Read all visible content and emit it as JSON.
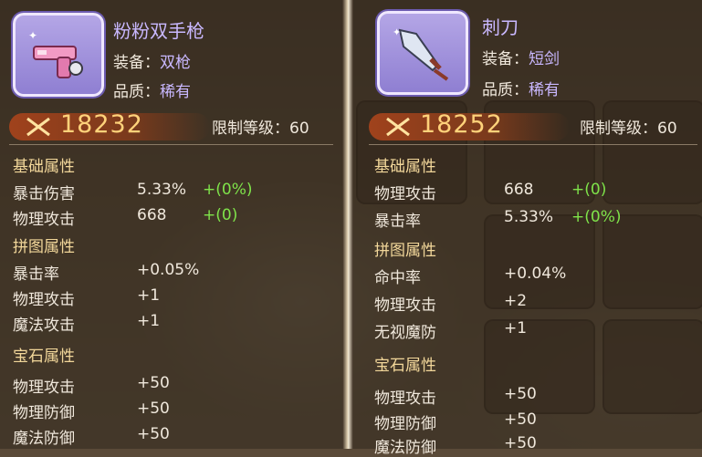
{
  "left": {
    "item_name": "粉粉双手枪",
    "equip_label": "装备：",
    "equip_value": "双枪",
    "quality_label": "品质：",
    "quality_value": "稀有",
    "power": "18232",
    "level_limit_label": "限制等级：",
    "level_limit_value": "60",
    "base_title": "基础属性",
    "base": [
      {
        "k": "暴击伤害",
        "v": "5.33%",
        "b": "+(0%)"
      },
      {
        "k": "物理攻击",
        "v": "668",
        "b": "+(0)"
      }
    ],
    "puzzle_title": "拼图属性",
    "puzzle": [
      {
        "k": "暴击率",
        "v": "+0.05%"
      },
      {
        "k": "物理攻击",
        "v": "+1"
      },
      {
        "k": "魔法攻击",
        "v": "+1"
      }
    ],
    "gem_title": "宝石属性",
    "gem": [
      {
        "k": "物理攻击",
        "v": "+50"
      },
      {
        "k": "物理防御",
        "v": "+50"
      },
      {
        "k": "魔法防御",
        "v": "+50"
      }
    ]
  },
  "right": {
    "item_name": "刺刀",
    "equip_label": "装备：",
    "equip_value": "短剑",
    "quality_label": "品质：",
    "quality_value": "稀有",
    "power": "18252",
    "level_limit_label": "限制等级：",
    "level_limit_value": "60",
    "base_title": "基础属性",
    "base": [
      {
        "k": "物理攻击",
        "v": "668",
        "b": "+(0)"
      },
      {
        "k": "暴击率",
        "v": "5.33%",
        "b": "+(0%)"
      }
    ],
    "puzzle_title": "拼图属性",
    "puzzle": [
      {
        "k": "命中率",
        "v": "+0.04%"
      },
      {
        "k": "物理攻击",
        "v": "+2"
      },
      {
        "k": "无视魔防",
        "v": "+1"
      }
    ],
    "gem_title": "宝石属性",
    "gem": [
      {
        "k": "物理攻击",
        "v": "+50"
      },
      {
        "k": "物理防御",
        "v": "+50"
      },
      {
        "k": "魔法防御",
        "v": "+50"
      }
    ]
  },
  "icons": {
    "left_item": "pink-pistol-icon",
    "right_item": "dagger-icon",
    "power": "crossed-swords-icon"
  }
}
